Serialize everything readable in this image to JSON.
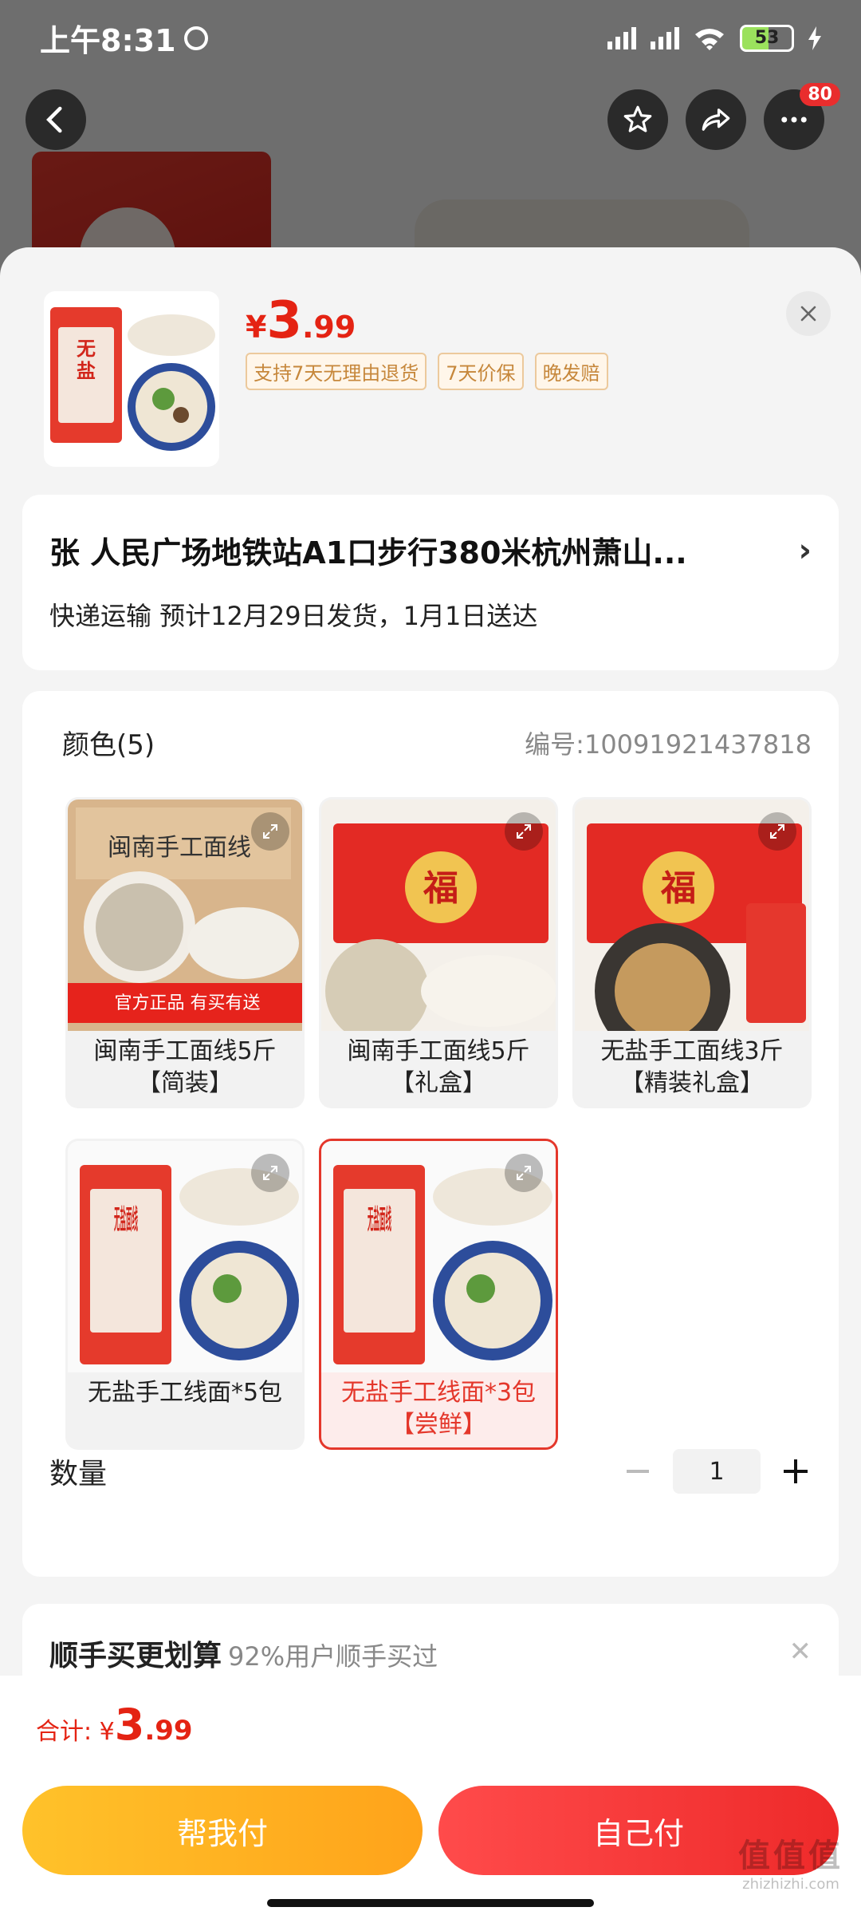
{
  "status_bar": {
    "time": "上午8:31",
    "battery": "53"
  },
  "nav": {
    "more_badge": "80"
  },
  "product": {
    "price_currency": "¥",
    "price_int": "3",
    "price_dec": ".99",
    "tags": [
      "支持7天无理由退货",
      "7天价保",
      "晚发赔"
    ]
  },
  "address": {
    "line1": "张  人民广场地铁站A1口步行380米杭州萧山...",
    "chevron": "›",
    "shipping": "快递运输 预计12月29日发货，1月1日送达"
  },
  "options": {
    "title": "颜色(5)",
    "code": "编号:10091921437818",
    "items": [
      {
        "label": "闽南手工面线5斤【简装】",
        "img_text": "闽南手工面线",
        "badge": "官方正品 有买有送"
      },
      {
        "label": "闽南手工面线5斤【礼盒】",
        "img_text": "福"
      },
      {
        "label": "无盐手工面线3斤【精装礼盒】",
        "img_text": "福"
      },
      {
        "label": "无盐手工线面*5包",
        "img_text": "无盐面线"
      },
      {
        "label": "无盐手工线面*3包【尝鲜】",
        "img_text": "无盐面线",
        "selected": true
      }
    ]
  },
  "quantity": {
    "label": "数量",
    "value": "1"
  },
  "upsell": {
    "title": "顺手买更划算",
    "subtitle": "92%用户顺手买过"
  },
  "footer": {
    "total_label": "合计: ",
    "total_currency": "¥",
    "total_int": "3",
    "total_dec": ".99",
    "help_pay": "帮我付",
    "self_pay": "自己付"
  },
  "watermark": {
    "big": "值值值",
    "small": "zhizhizhi.com"
  },
  "colors": {
    "accent_red": "#e42313",
    "help_yellow": "#ffb020",
    "tag_gold": "#c6873b"
  }
}
